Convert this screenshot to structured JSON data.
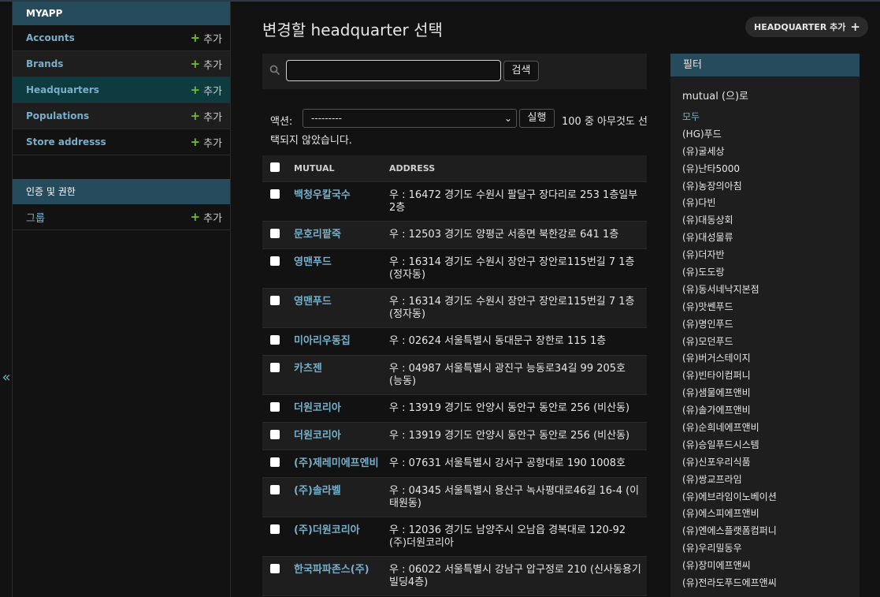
{
  "sidebar": {
    "app_caption": "MYAPP",
    "add_label": "추가",
    "models": [
      {
        "label": "Accounts"
      },
      {
        "label": "Brands"
      },
      {
        "label": "Headquarters"
      },
      {
        "label": "Populations"
      },
      {
        "label": "Store addresss"
      }
    ],
    "auth_caption": "인증 및 권한",
    "auth_models": [
      {
        "label": "그룹"
      }
    ],
    "collapse_glyph": "«"
  },
  "header": {
    "title": "변경할 headquarter 선택",
    "add_button": "HEADQUARTER 추가"
  },
  "search": {
    "value": "",
    "button": "검색"
  },
  "actions": {
    "label": "액션:",
    "selected": "---------",
    "go_button": "실행",
    "counter_part1": "100 중 아무것도 선",
    "counter_part2": "택되지 않았습니다."
  },
  "table": {
    "columns": [
      "MUTUAL",
      "ADDRESS"
    ],
    "rows": [
      {
        "mutual": "백청우칼국수",
        "address": "우 : 16472 경기도 수원시 팔달구 장다리로 253 1층일부 2층"
      },
      {
        "mutual": "문호리팥죽",
        "address": "우 : 12503 경기도 양평군 서종면 북한강로 641 1층"
      },
      {
        "mutual": "영맨푸드",
        "address": "우 : 16314 경기도 수원시 장안구 장안로115번길 7 1층 (정자동)"
      },
      {
        "mutual": "영맨푸드",
        "address": "우 : 16314 경기도 수원시 장안구 장안로115번길 7 1층 (정자동)"
      },
      {
        "mutual": "미아리우동집",
        "address": "우 : 02624 서울특별시 동대문구 장한로 115 1층"
      },
      {
        "mutual": "카츠젠",
        "address": "우 : 04987 서울특별시 광진구 능동로34길 99 205호 (능동)"
      },
      {
        "mutual": "더원코리아",
        "address": "우 : 13919 경기도 안양시 동안구 동안로 256 (비산동)"
      },
      {
        "mutual": "더원코리아",
        "address": "우 : 13919 경기도 안양시 동안구 동안로 256 (비산동)"
      },
      {
        "mutual": "(주)제레미에프엔비",
        "address": "우 : 07631 서울특별시 강서구 공항대로 190 1008호"
      },
      {
        "mutual": "(주)솔라벨",
        "address": "우 : 04345 서울특별시 용산구 녹사평대로46길 16-4 (이태원동)"
      },
      {
        "mutual": "(주)더원코리아",
        "address": "우 : 12036 경기도 남양주시 오남읍 경복대로 120-92 (주)더원코리아"
      },
      {
        "mutual": "한국파파존스(주)",
        "address": "우 : 06022 서울특별시 강남구 압구정로 210 (신사동용기빌딩4층)"
      }
    ]
  },
  "filter": {
    "title": "필터",
    "subtitle": "mutual (으)로",
    "items": [
      "모두",
      "(HG)푸드",
      "(유)굴세상",
      "(유)난타5000",
      "(유)농장의아침",
      "(유)다빈",
      "(유)대동상회",
      "(유)대성물류",
      "(유)더자반",
      "(유)도도랑",
      "(유)동서네낙지본점",
      "(유)맛쎈푸드",
      "(유)명인푸드",
      "(유)모던푸드",
      "(유)버거스테이지",
      "(유)빈타이컴퍼니",
      "(유)샘물에프앤비",
      "(유)솔가에프앤비",
      "(유)순희네에프앤비",
      "(유)승일푸드시스템",
      "(유)신포우리식품",
      "(유)쌍교프라임",
      "(유)에브라임이노베이션",
      "(유)에스피에프앤비",
      "(유)엔에스플랫폼컴퍼니",
      "(유)우리밀동우",
      "(유)장미에프앤씨",
      "(유)전라도푸드에프앤씨"
    ]
  },
  "colors": {
    "accent": "#79aec8",
    "header_bg": "#264b5d",
    "plus": "#70bf2b",
    "current_row": "#0d3b40"
  }
}
